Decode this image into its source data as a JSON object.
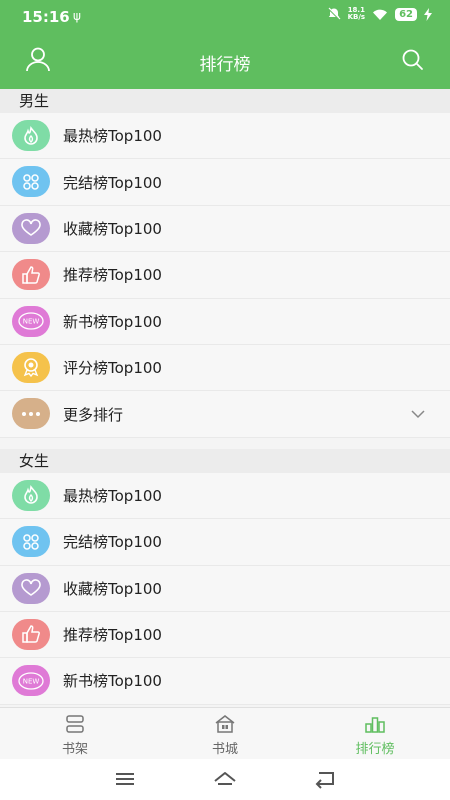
{
  "status_bar": {
    "time": "15:16",
    "usb_icon": "ψ",
    "speed_value": "18.1",
    "speed_unit": "KB/s",
    "battery": "62"
  },
  "header": {
    "title": "排行榜"
  },
  "sections": [
    {
      "title": "男生",
      "items": [
        {
          "label": "最热榜Top100",
          "icon": "flame-icon",
          "color": "#7fdca6"
        },
        {
          "label": "完结榜Top100",
          "icon": "grid-icon",
          "color": "#6fc3f0"
        },
        {
          "label": "收藏榜Top100",
          "icon": "heart-icon",
          "color": "#b59ad0"
        },
        {
          "label": "推荐榜Top100",
          "icon": "thumbs-up-icon",
          "color": "#f08a8a"
        },
        {
          "label": "新书榜Top100",
          "icon": "new-badge-icon",
          "color": "#df7ad6"
        },
        {
          "label": "评分榜Top100",
          "icon": "award-icon",
          "color": "#f5c24b"
        },
        {
          "label": "更多排行",
          "icon": "more-icon",
          "color": "#d6b08a"
        }
      ]
    },
    {
      "title": "女生",
      "items": [
        {
          "label": "最热榜Top100",
          "icon": "flame-icon",
          "color": "#7fdca6"
        },
        {
          "label": "完结榜Top100",
          "icon": "grid-icon",
          "color": "#6fc3f0"
        },
        {
          "label": "收藏榜Top100",
          "icon": "heart-icon",
          "color": "#b59ad0"
        },
        {
          "label": "推荐榜Top100",
          "icon": "thumbs-up-icon",
          "color": "#f08a8a"
        },
        {
          "label": "新书榜Top100",
          "icon": "new-badge-icon",
          "color": "#df7ad6"
        }
      ]
    }
  ],
  "new_badge_text": "NEW",
  "tabbar": {
    "tabs": [
      {
        "label": "书架",
        "icon": "bookshelf-icon"
      },
      {
        "label": "书城",
        "icon": "store-icon"
      },
      {
        "label": "排行榜",
        "icon": "ranking-icon",
        "active": true
      }
    ]
  },
  "colors": {
    "primary": "#5fbe5f"
  }
}
